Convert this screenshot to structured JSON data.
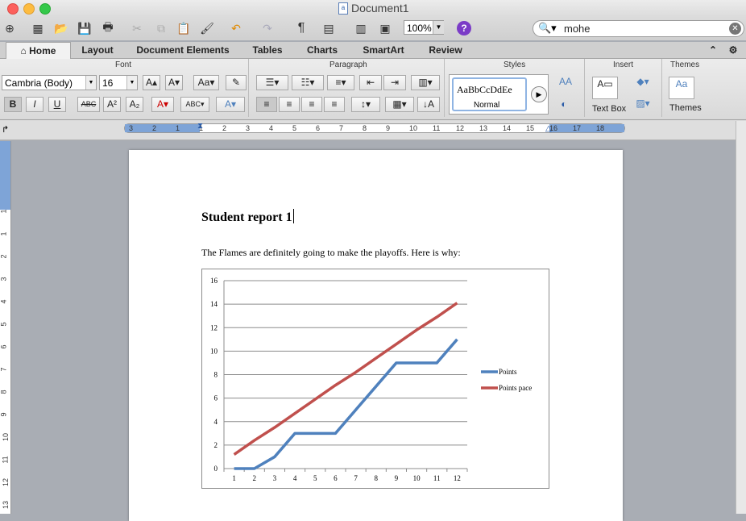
{
  "window": {
    "title": "Document1"
  },
  "toolbar": {
    "zoom": "100%",
    "search_value": "mohe",
    "help_label": "?"
  },
  "tabs": [
    "Home",
    "Layout",
    "Document Elements",
    "Tables",
    "Charts",
    "SmartArt",
    "Review"
  ],
  "ribbon": {
    "groups": {
      "font": "Font",
      "paragraph": "Paragraph",
      "styles": "Styles",
      "insert": "Insert",
      "themes": "Themes"
    },
    "font_name": "Cambria (Body)",
    "font_size": "16",
    "style_sample": "AaBbCcDdEe",
    "style_name": "Normal",
    "text_box_label": "Text Box",
    "themes_label": "Themes",
    "theme_sample": "Aa"
  },
  "document": {
    "title": "Student report 1",
    "body": "The Flames are definitely going to make the playoffs. Here is why:"
  },
  "colors": {
    "accent": "#4f81bd",
    "series_points": "#4f81bd",
    "series_pace": "#c0504d"
  },
  "ruler": {
    "numbers": [
      "3",
      "2",
      "1",
      "1",
      "2",
      "3",
      "4",
      "5",
      "6",
      "7",
      "8",
      "9",
      "10",
      "11",
      "12",
      "13",
      "14",
      "15",
      "16",
      "17",
      "18"
    ]
  },
  "chart_data": {
    "type": "line",
    "categories": [
      1,
      2,
      3,
      4,
      5,
      6,
      7,
      8,
      9,
      10,
      11,
      12
    ],
    "series": [
      {
        "name": "Points",
        "values": [
          0,
          0,
          1,
          3,
          3,
          3,
          5,
          7,
          9,
          9,
          9,
          11
        ]
      },
      {
        "name": "Points pace",
        "values": [
          1.2,
          2.4,
          3.5,
          4.7,
          5.9,
          7.1,
          8.2,
          9.4,
          10.6,
          11.8,
          12.9,
          14.1
        ]
      }
    ],
    "yticks": [
      "0",
      "2",
      "4",
      "6",
      "8",
      "10",
      "12",
      "14",
      "16"
    ],
    "xticks": [
      "1",
      "2",
      "3",
      "4",
      "5",
      "6",
      "7",
      "8",
      "9",
      "10",
      "11",
      "12"
    ],
    "ylim": [
      0,
      16
    ],
    "grid": true,
    "legend": "right"
  }
}
